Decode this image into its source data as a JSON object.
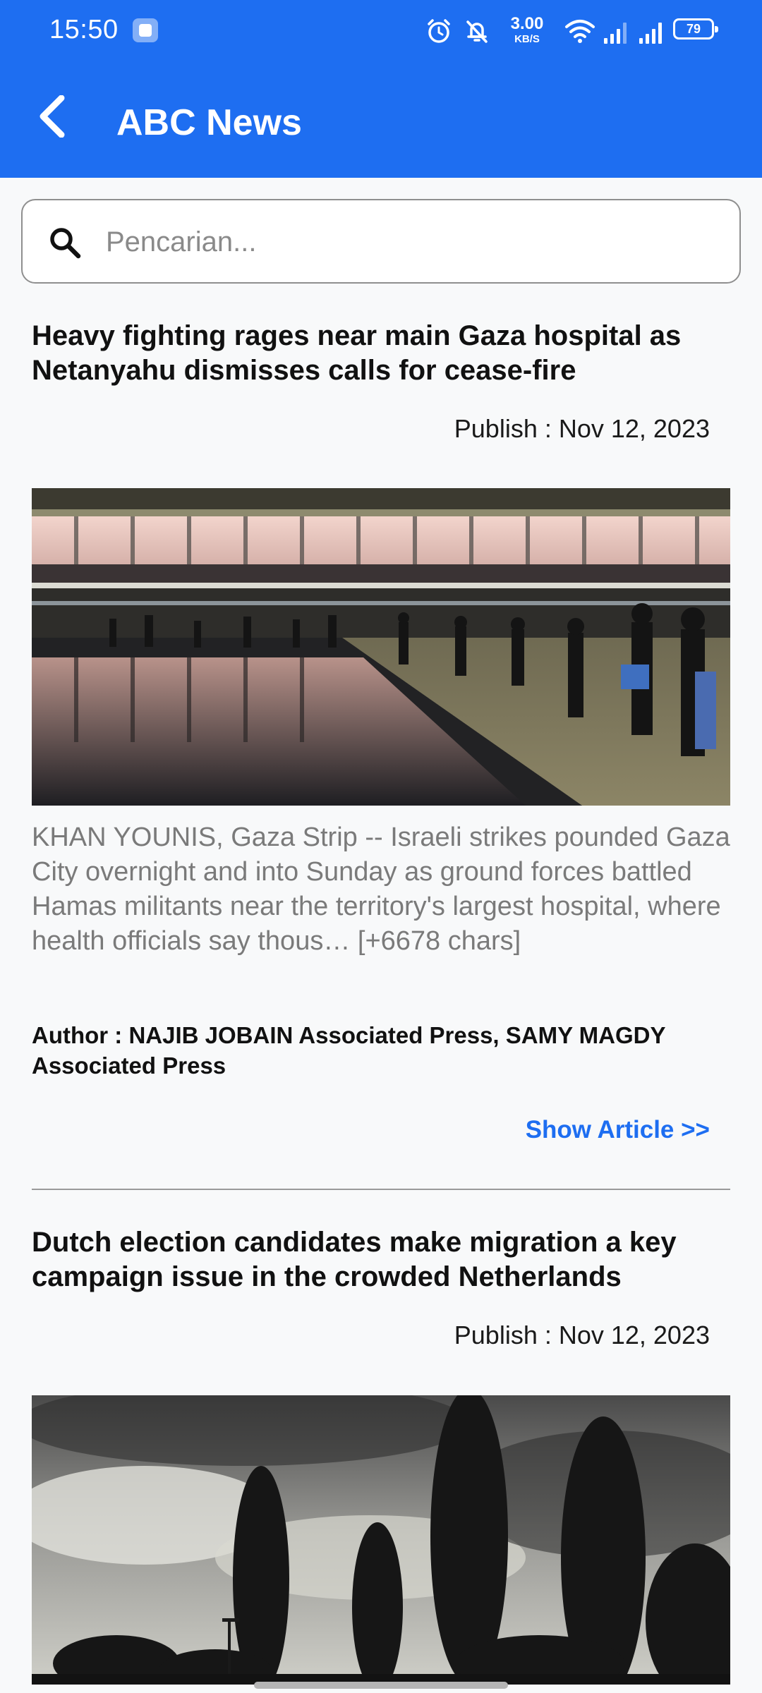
{
  "status_bar": {
    "time": "15:50",
    "net_speed_value": "3.00",
    "net_speed_unit": "KB/S",
    "battery_level": "79",
    "icons": [
      "app-notification-icon",
      "alarm-icon",
      "mute-icon",
      "wifi-icon",
      "signal-icon",
      "signal-icon",
      "battery-icon"
    ]
  },
  "app_bar": {
    "title": "ABC News",
    "back_icon": "chevron-left-icon"
  },
  "search": {
    "placeholder": "Pencarian...",
    "value": "",
    "icon": "search-icon"
  },
  "articles": [
    {
      "title": "Heavy fighting rages near main Gaza hospital as Netanyahu dismisses calls for cease-fire",
      "date": "Publish : Nov 12, 2023",
      "image_subject": "night-plaza-crowd-reflection",
      "description": "KHAN YOUNIS, Gaza Strip -- Israeli strikes pounded Gaza City overnight and into Sunday as ground forces battled Hamas militants near the territory's largest hospital, where health officials say thous… [+6678 chars]",
      "author": "Author : NAJIB JOBAIN Associated Press, SAMY MAGDY Associated Press",
      "link_label": "Show Article >>"
    },
    {
      "title": "Dutch election candidates make migration a key campaign issue in the crowded Netherlands",
      "date": "Publish : Nov 12, 2023",
      "image_subject": "cloudy-sky-trees-silhouette"
    }
  ],
  "colors": {
    "primary": "#1e6ef1",
    "background": "#f8f9fa",
    "link": "#1e6ef1",
    "description_text": "#7a7a7a"
  }
}
